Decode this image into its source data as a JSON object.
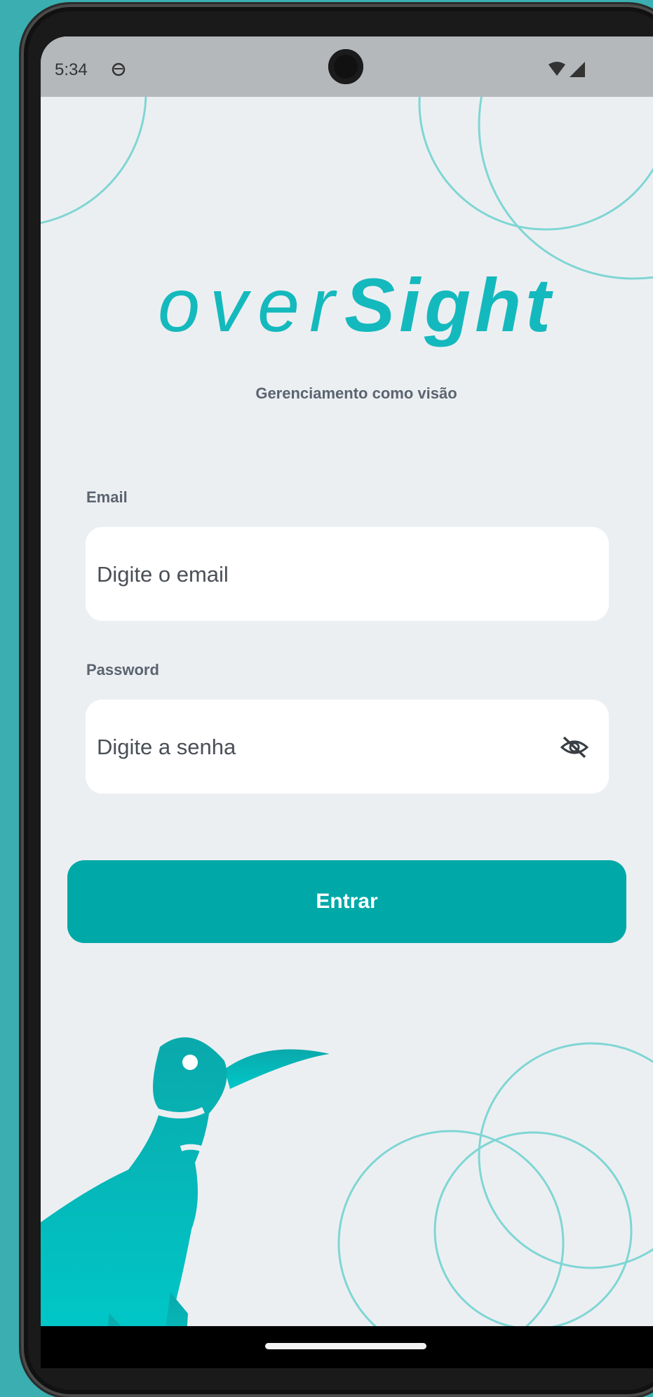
{
  "status_bar": {
    "time": "5:34"
  },
  "brand": {
    "logo_light": "over",
    "logo_bold": "Sight",
    "tagline": "Gerenciamento como visão",
    "color": "#14b9bd"
  },
  "form": {
    "email_label": "Email",
    "email_placeholder": "Digite o email",
    "password_label": "Password",
    "password_placeholder": "Digite a senha",
    "password_toggle_icon": "eye-off-icon",
    "submit_label": "Entrar",
    "submit_color": "#00a8a8"
  }
}
